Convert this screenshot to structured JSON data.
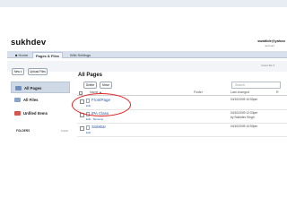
{
  "header": {
    "site_title": "sukhdev",
    "user_email": "swatiblr@yahoo",
    "account_link": "account"
  },
  "nav": {
    "home": "■ Home",
    "pages_files": "Pages & Files",
    "wiki_settings": "Wiki Settings"
  },
  "toolbar": {
    "new_label": "New ▾",
    "upload_label": "Upload Files",
    "util_right": "Insert file ▾"
  },
  "sidebar": {
    "items": [
      {
        "label": "All Pages",
        "icon": "pages-icon"
      },
      {
        "label": "All Files",
        "icon": "files-icon"
      },
      {
        "label": "Unfiled Items",
        "icon": "unfiled-icon"
      }
    ],
    "folders_label": "FOLDERS",
    "folders_count": "0 add"
  },
  "main": {
    "title": "All Pages",
    "delete_label": "Delete",
    "move_label": "Move",
    "search_placeholder": "Search",
    "columns": {
      "name": "Name ▲",
      "folder": "Folder",
      "last_changed": "Last changed",
      "r": "R"
    },
    "rows": [
      {
        "name": "FrontPage",
        "sub": "Edit",
        "date": "04/10/2009 10:50pm",
        "by": ""
      },
      {
        "name": "IPA Class",
        "sub": "Edit · Rename",
        "date": "04/10/2009 12:03pm",
        "by": "by Sukhdev Singh"
      },
      {
        "name": "SideBar",
        "sub": "Edit",
        "date": "04/10/2009 10:50pm",
        "by": ""
      }
    ]
  },
  "colors": {
    "accent": "#2b5aa8",
    "highlight": "#e02020",
    "nav_bg": "#d7e0ec"
  }
}
